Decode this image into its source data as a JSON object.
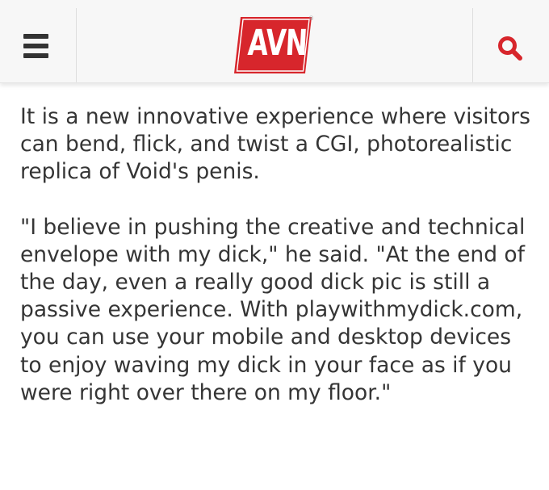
{
  "header": {
    "menu_icon": "hamburger-menu-icon",
    "logo_text": "AVN",
    "logo_registered": "®",
    "search_icon": "search-icon",
    "accent_color": "#d7262c"
  },
  "article": {
    "paragraphs": [
      {
        "lines": [
          "It is a new innovative experience where visitors",
          "can bend, flick, and twist a CGI, photorealistic",
          "replica of Void's penis."
        ]
      },
      {
        "lines": [
          "\"I believe in pushing the creative and technical",
          "envelope with my dick,\" he said. \"At the end of",
          "the day, even a really good dick pic is still a",
          "passive experience. With playwithmydick.com,",
          "you can use your mobile and desktop devices",
          "to enjoy waving my dick in your face as if you",
          "were right over there on my floor.\""
        ]
      }
    ]
  }
}
